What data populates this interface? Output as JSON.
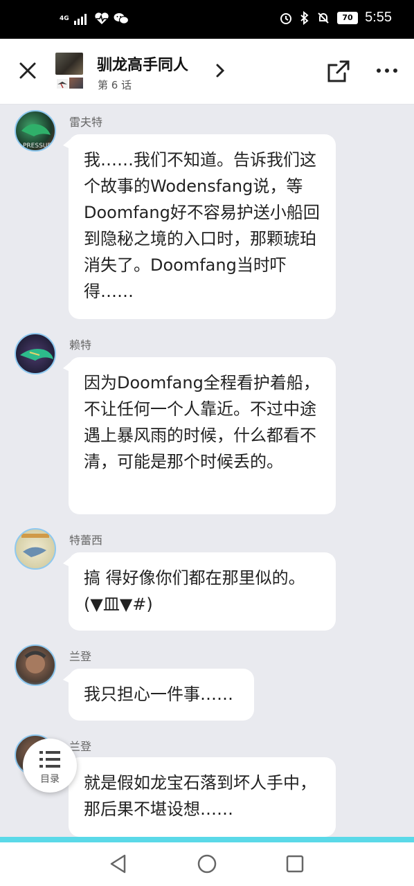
{
  "status_bar": {
    "network": "4G",
    "network_sub": "4G",
    "battery": "70",
    "time": "5:55",
    "icons": [
      "signal-icon",
      "heart-pulse-icon",
      "wechat-icon",
      "alarm-icon",
      "bluetooth-icon",
      "mute-bell-icon",
      "battery-icon"
    ]
  },
  "header": {
    "title": "驯龙高手同人",
    "subtitle": "第 6 话"
  },
  "messages": [
    {
      "author": "雷夫特",
      "text": "我……我们不知道。告诉我们这个故事的Wodensfang说，等Doomfang好不容易护送小船回到隐秘之境的入口时，那颗琥珀消失了。Doomfang当时吓得……"
    },
    {
      "author": "赖特",
      "text": "因为Doomfang全程看护着船，不让任何一个人靠近。不过中途遇上暴风雨的时候，什么都看不清，可能是那个时候丢的。"
    },
    {
      "author": "特蕾西",
      "text": "搞 得好像你们都在那里似的。(▼皿▼#)"
    },
    {
      "author": "兰登",
      "text": "我只担心一件事……"
    },
    {
      "author": "兰登",
      "text": "就是假如龙宝石落到坏人手中，那后果不堪设想……"
    }
  ],
  "toc": {
    "label": "目录"
  },
  "colors": {
    "accent": "#5ad9e8",
    "background": "#e9eaef",
    "avatar_ring": "#8ec8ef"
  }
}
